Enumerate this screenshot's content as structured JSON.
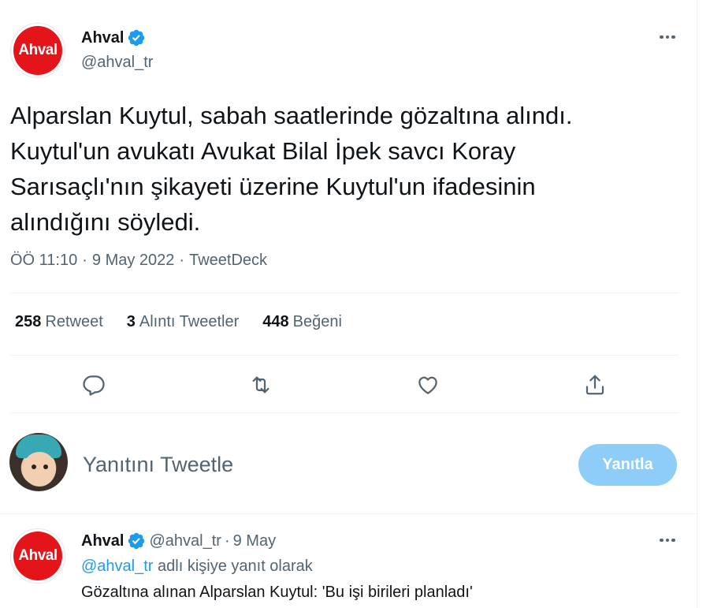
{
  "tweet": {
    "author_name": "Ahval",
    "author_handle": "@ahval_tr",
    "avatar_text": "Ahval",
    "text": "Alparslan Kuytul, sabah saatlerinde gözaltına alındı.\nKuytul'un avukatı Avukat Bilal İpek savcı Koray\nSarısaçlı'nın şikayeti üzerine Kuytul'un ifadesinin\nalındığını söyledi.",
    "time": "ÖÖ 11:10",
    "dot1": "·",
    "date": "9 May 2022",
    "dot2": "·",
    "source": "TweetDeck"
  },
  "stats": [
    {
      "count": "258",
      "label": "Retweet"
    },
    {
      "count": "3",
      "label": "Alıntı Tweetler"
    },
    {
      "count": "448",
      "label": "Beğeni"
    }
  ],
  "actions": {
    "reply_icon": "reply-icon",
    "retweet_icon": "retweet-icon",
    "like_icon": "heart-icon",
    "share_icon": "share-icon"
  },
  "composer": {
    "placeholder": "Yanıtını Tweetle",
    "button_label": "Yanıtla"
  },
  "reply_tweet": {
    "author_name": "Ahval",
    "author_handle": "@ahval_tr",
    "dot": "·",
    "date": "9 May",
    "avatar_text": "Ahval",
    "replying_to_handle": "@ahval_tr",
    "replying_to_suffix": " adlı kişiye yanıt olarak",
    "text": "Gözaltına alınan Alparslan Kuytul: 'Bu işi birileri planladı'"
  },
  "colors": {
    "accent": "#1d9bf0",
    "brand_red": "#e3151a",
    "muted": "#536471",
    "button_disabled": "#8ecdf8"
  }
}
